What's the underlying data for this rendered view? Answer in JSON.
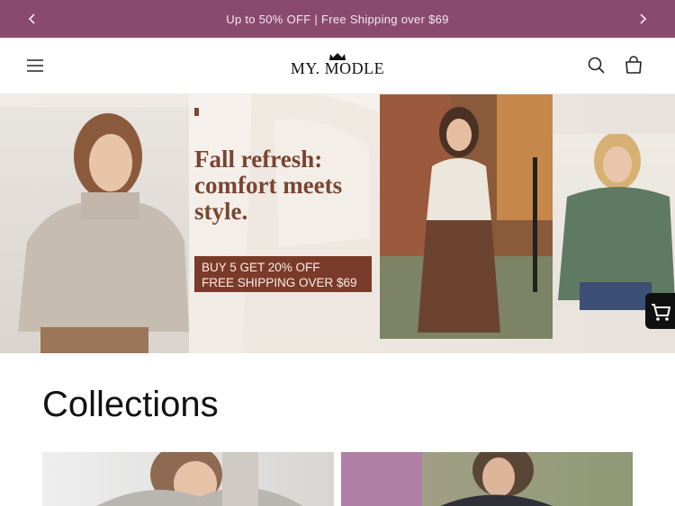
{
  "announcement": {
    "text": "Up to 50% OFF | Free Shipping over $69",
    "prev_icon": "chevron-left-icon",
    "next_icon": "chevron-right-icon"
  },
  "header": {
    "logo_text": "MY. MODLE",
    "menu_icon": "hamburger-icon",
    "search_icon": "search-icon",
    "cart_icon": "bag-icon"
  },
  "hero": {
    "headline": "Fall refresh: comfort meets style.",
    "promo_line_1": "BUY 5 GET 20% OFF",
    "promo_line_2": "FREE SHIPPING OVER $69"
  },
  "floating_cart": {
    "icon": "cart-icon"
  },
  "collections": {
    "title": "Collections"
  },
  "colors": {
    "announcement_bg": "#8a4a6e",
    "promo_bg": "#7b3b2a",
    "headline": "#7a4531"
  }
}
